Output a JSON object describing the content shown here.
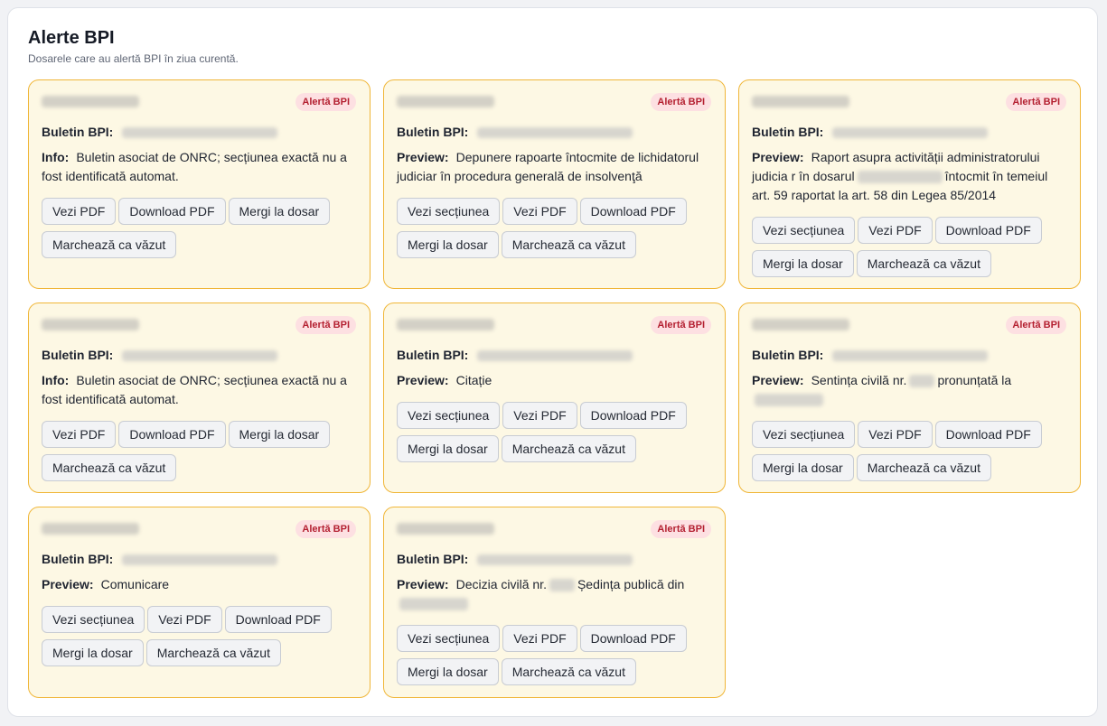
{
  "header": {
    "title": "Alerte BPI",
    "subtitle": "Dosarele care au alertă BPI în ziua curentă."
  },
  "labels": {
    "badge": "Alertă BPI",
    "bulletin": "Buletin BPI:",
    "info": "Info:",
    "preview": "Preview:"
  },
  "buttons": {
    "section": "Vezi secțiunea",
    "view_pdf": "Vezi PDF",
    "download_pdf": "Download PDF",
    "go_case": "Mergi la dosar",
    "mark_seen": "Marchează ca văzut"
  },
  "cards": [
    {
      "kind": "Info:",
      "text": "Buletin asociat de ONRC; secțiunea exactă nu a fost identificată automat."
    },
    {
      "kind": "Preview:",
      "text": "Depunere rapoarte întocmite de lichidatorul judiciar în procedura generală de insolvenţă"
    },
    {
      "kind": "Preview:",
      "text_a": "Raport asupra activității administratorului judicia r în dosarul",
      "text_b": "întocmit în temeiul art. 59 raportat la art. 58 din Legea 85/2014"
    },
    {
      "kind": "Info:",
      "text": "Buletin asociat de ONRC; secțiunea exactă nu a fost identificată automat."
    },
    {
      "kind": "Preview:",
      "text": "Citație"
    },
    {
      "kind": "Preview:",
      "text_a": "Sentința civilă nr.",
      "text_b": "pronunțată la"
    },
    {
      "kind": "Preview:",
      "text": "Comunicare"
    },
    {
      "kind": "Preview:",
      "text_a": "Decizia civilă nr.",
      "text_b": "Ședința publică din"
    }
  ]
}
